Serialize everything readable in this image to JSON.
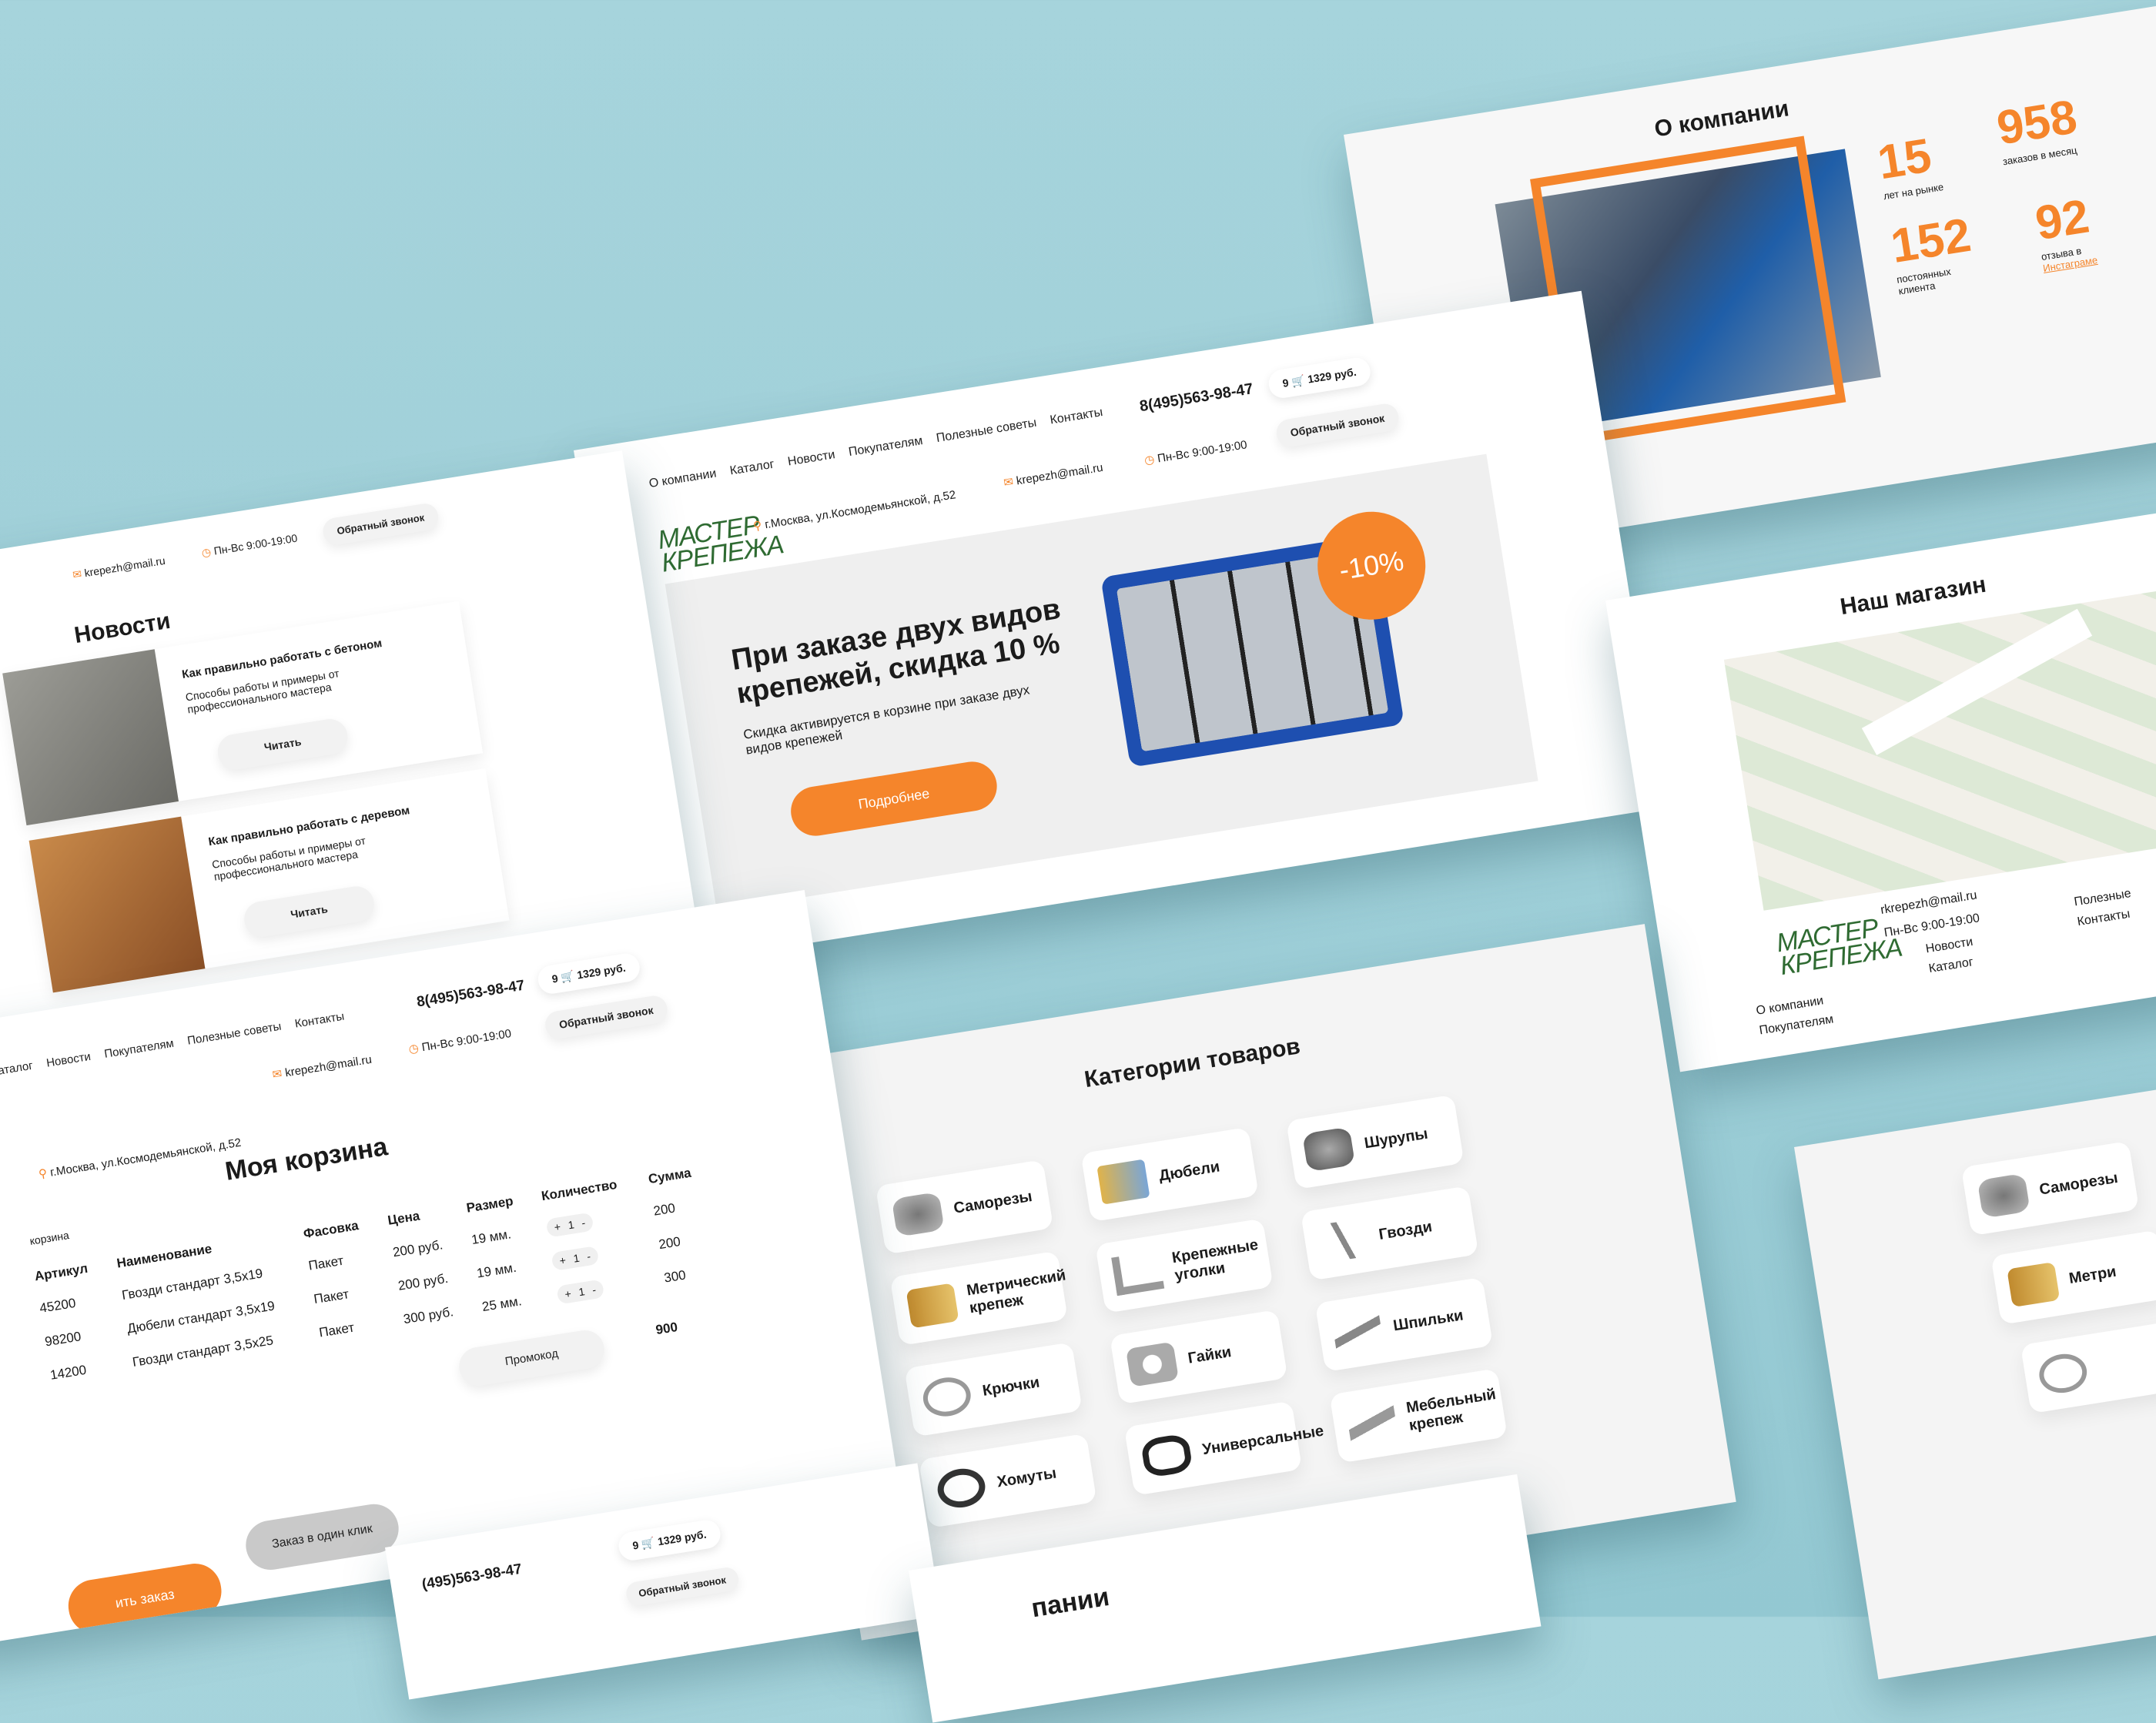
{
  "brand": {
    "logo_line1": "МАСТЕР",
    "logo_line2": "КРЕПЕЖА",
    "accent": "#f5852b",
    "green": "#2f6b32"
  },
  "header": {
    "nav": [
      "О компании",
      "Каталог",
      "Новости",
      "Покупателям",
      "Полезные советы",
      "Контакты"
    ],
    "address": "г.Москва, ул.Космодемьянской, д.52",
    "email": "krepezh@mail.ru",
    "hours_label": "Пн-Вс",
    "hours": "9:00-19:00",
    "phone": "8(495)563-98-47",
    "cart_count": "9",
    "cart_total": "1329 руб.",
    "callback": "Обратный звонок"
  },
  "hero": {
    "title": "При заказе двух видов крепежей, скидка 10 %",
    "subtitle": "Скидка активируется в корзине при заказе двух видов крепежей",
    "button": "Подробнее",
    "badge": "-10%"
  },
  "about": {
    "title": "О компании",
    "stats": [
      {
        "value": "15",
        "label": "лет на рынке"
      },
      {
        "value": "958",
        "label": "заказов в месяц"
      },
      {
        "value": "152",
        "label": "постоянных клиента"
      },
      {
        "value": "92",
        "label": "отзыва в",
        "link": "Инстаграме"
      }
    ]
  },
  "news": {
    "title": "Новости",
    "items": [
      {
        "title": "Как правильно работать с бетоном",
        "text": "Способы работы и примеры от профессионального мастера",
        "button": "Читать"
      },
      {
        "title": "Как правильно работать с деревом",
        "text": "Способы работы и примеры от профессионального мастера",
        "button": "Читать"
      }
    ]
  },
  "categories": {
    "title": "Категории товаров",
    "items": [
      "Саморезы",
      "Дюбели",
      "Шурупы",
      "Метрический крепеж",
      "Крепежные уголки",
      "Гвозди",
      "Крючки",
      "Гайки",
      "Шпильки",
      "Хомуты",
      "Универсальные",
      "Мебельный крепеж"
    ]
  },
  "store": {
    "title": "Наш магазин",
    "email": "rkrepezh@mail.ru",
    "hours_label": "Пн-Вс",
    "hours": "9:00-19:00",
    "footer_nav": [
      "О компании",
      "Покупателям",
      "Новости",
      "Каталог",
      "Полезные",
      "Контакты"
    ]
  },
  "cart": {
    "title": "Моя корзина",
    "side_label": "корзина",
    "address": "г.Москва, ул.Космодемьянской, д.52",
    "nav": [
      "Каталог",
      "Новости",
      "Покупателям",
      "Полезные советы",
      "Контакты"
    ],
    "columns": [
      "Артикул",
      "Наименование",
      "Фасовка",
      "Цена",
      "Размер",
      "Количество",
      "Сумма"
    ],
    "rows": [
      {
        "sku": "45200",
        "name": "Гвозди стандарт 3,5x19",
        "pack": "Пакет",
        "price": "200 руб.",
        "size": "19 мм.",
        "qty": "1",
        "sum": "200"
      },
      {
        "sku": "98200",
        "name": "Дюбели стандарт 3,5x19",
        "pack": "Пакет",
        "price": "200 руб.",
        "size": "19 мм.",
        "qty": "1",
        "sum": "200"
      },
      {
        "sku": "14200",
        "name": "Гвозди стандарт 3,5x25",
        "pack": "Пакет",
        "price": "300 руб.",
        "size": "25 мм.",
        "qty": "1",
        "sum": "300"
      }
    ],
    "promo": "Промокод",
    "total": "900",
    "one_click": "Заказ в один клик",
    "checkout": "ить заказ"
  },
  "bottom_header": {
    "phone": "(495)563-98-47",
    "cart_count": "9",
    "cart_total": "1329 руб.",
    "callback": "Обратный звонок"
  },
  "bottom_title_partial": "пании",
  "right_partial": {
    "items": [
      "Саморезы",
      "Метри"
    ]
  }
}
